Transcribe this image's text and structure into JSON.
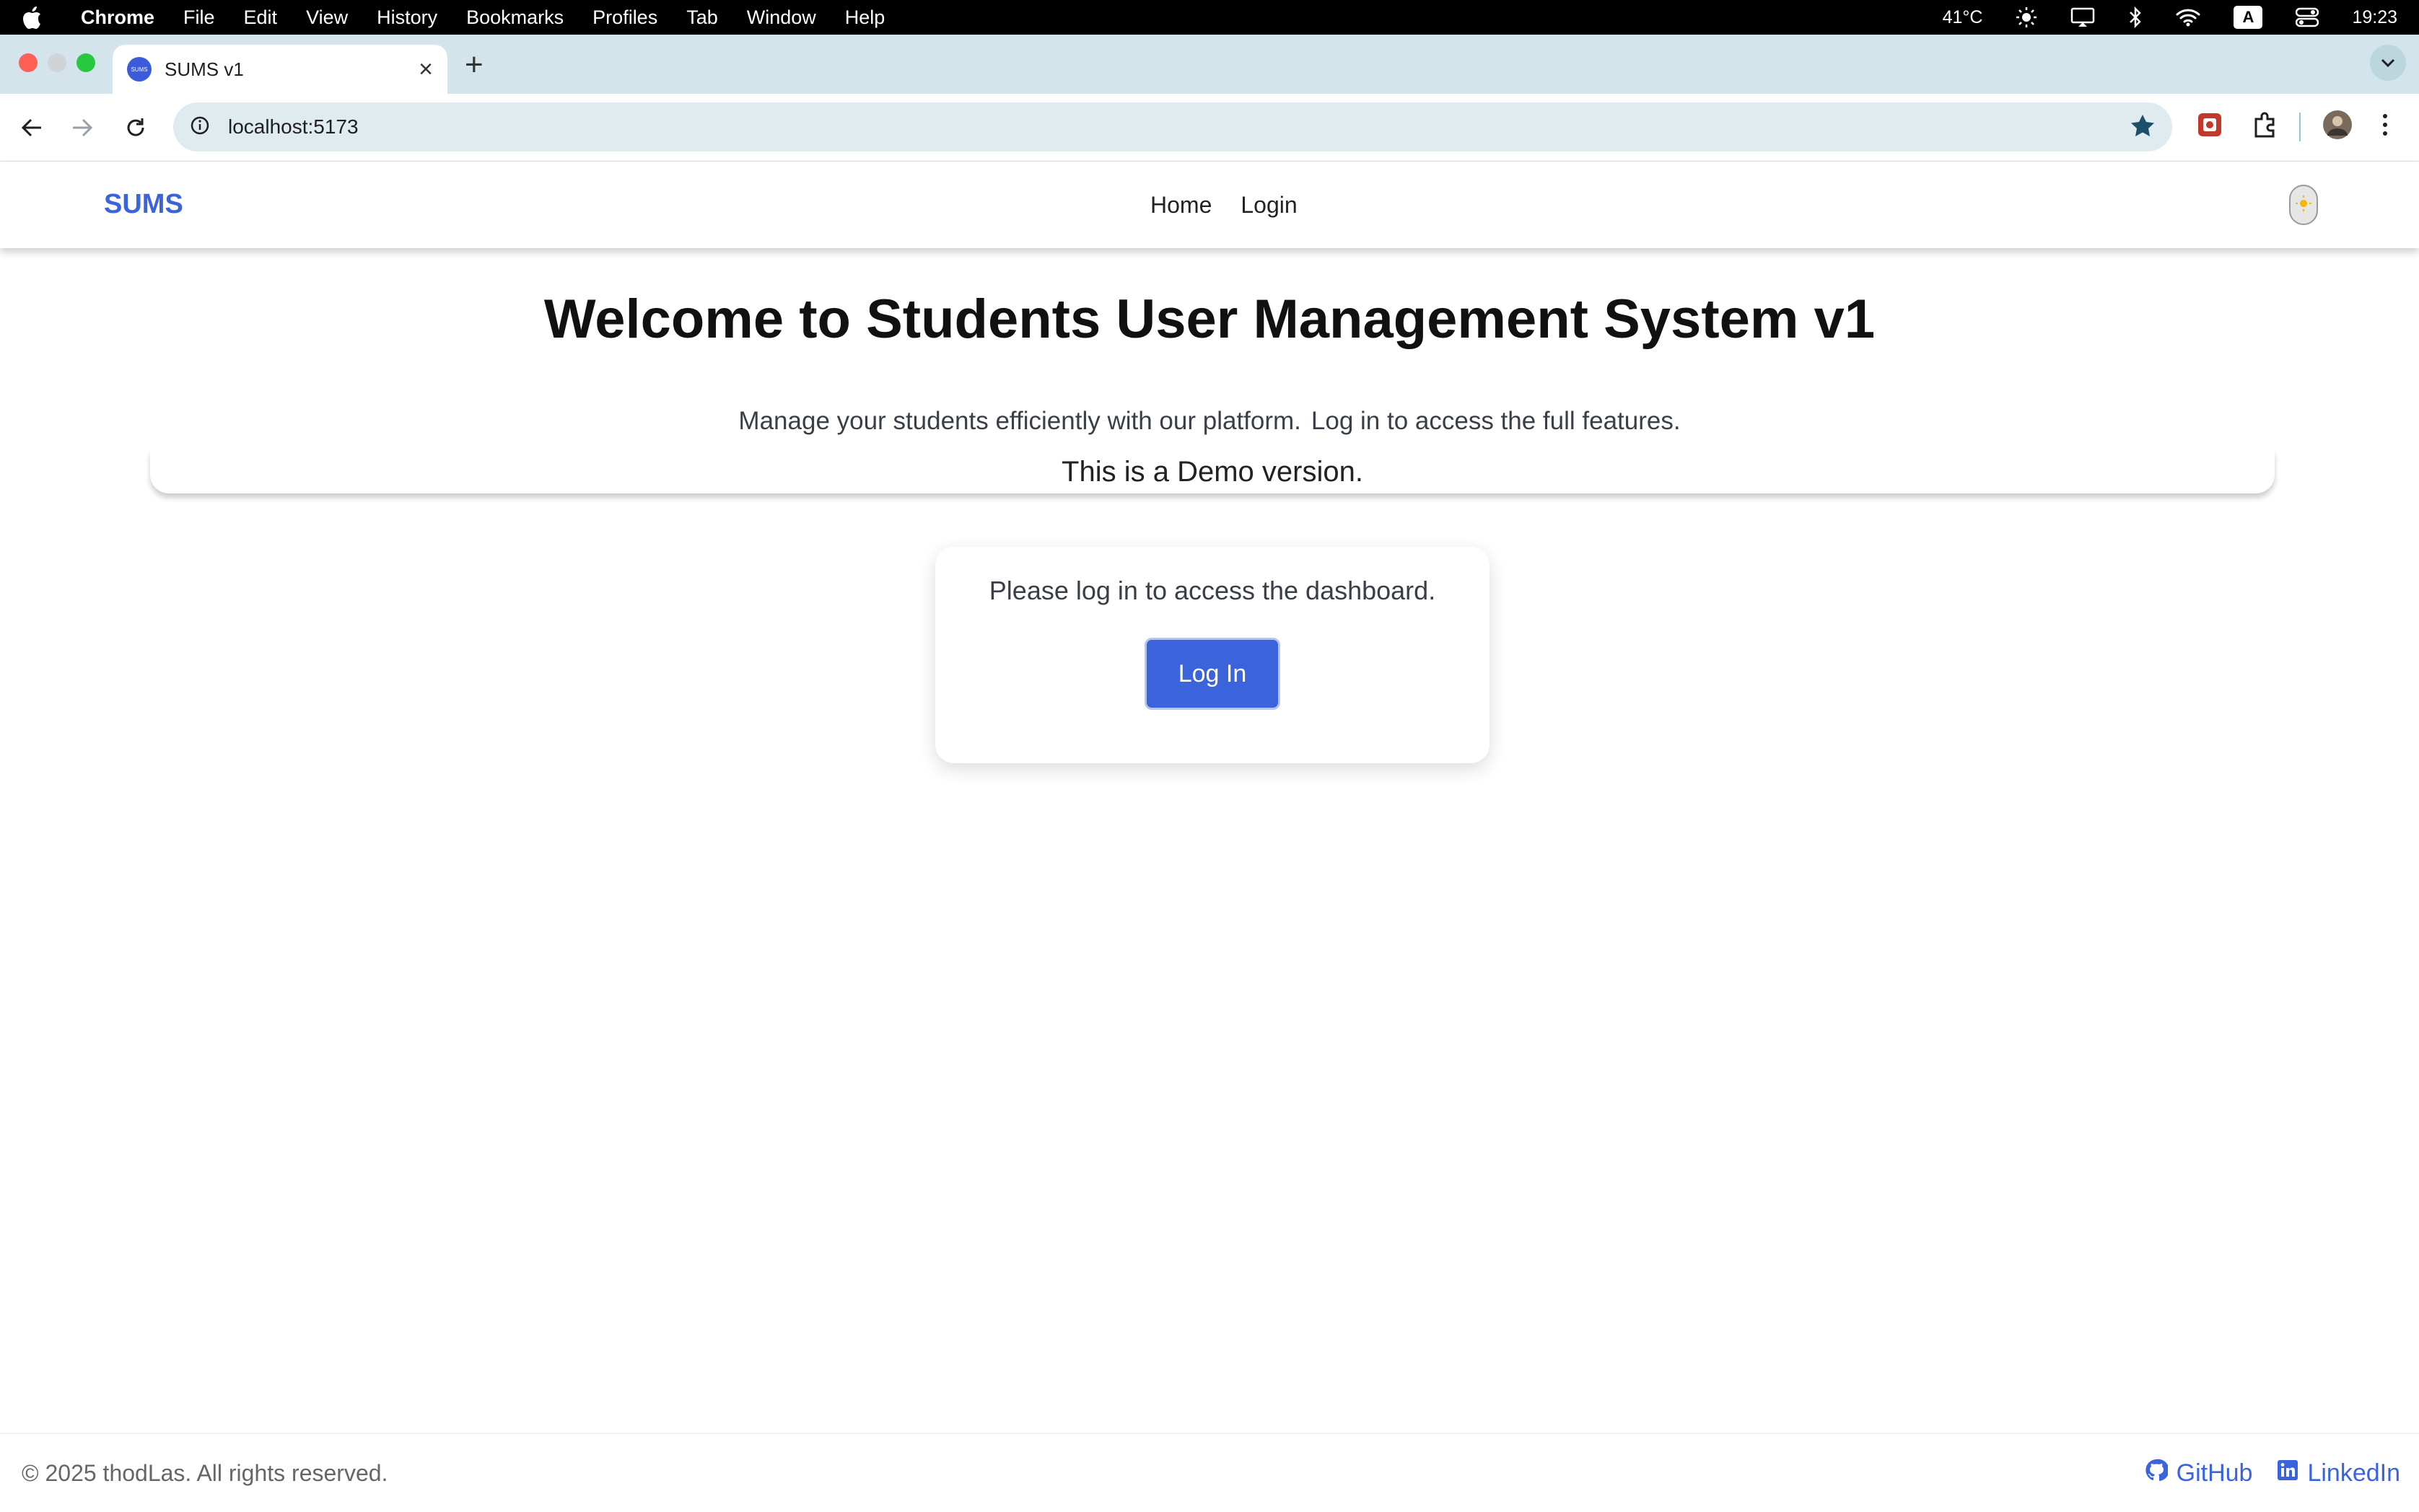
{
  "menubar": {
    "app_name": "Chrome",
    "items": [
      "File",
      "Edit",
      "View",
      "History",
      "Bookmarks",
      "Profiles",
      "Tab",
      "Window",
      "Help"
    ],
    "temperature": "41°C",
    "input_source": "A",
    "time": "19:23"
  },
  "browser": {
    "tab_title": "SUMS v1",
    "favicon_text": "SUMS",
    "url": "localhost:5173"
  },
  "app": {
    "brand": "SUMS",
    "nav": {
      "home": "Home",
      "login": "Login"
    },
    "hero": {
      "title": "Welcome to Students User Management System v1",
      "subtitle_1": "Manage your students efficiently with our platform.",
      "subtitle_2": "Log in to access the full features.",
      "demo_notice": "This is a Demo version."
    },
    "login_card": {
      "message": "Please log in to access the dashboard.",
      "button": "Log In"
    },
    "footer": {
      "copyright": "© 2025 thodLas. All rights reserved.",
      "github": "GitHub",
      "linkedin": "LinkedIn"
    }
  },
  "colors": {
    "accent": "#3b63dc",
    "tabstrip": "#d3e4ea",
    "omnibox": "#e0ebef"
  }
}
